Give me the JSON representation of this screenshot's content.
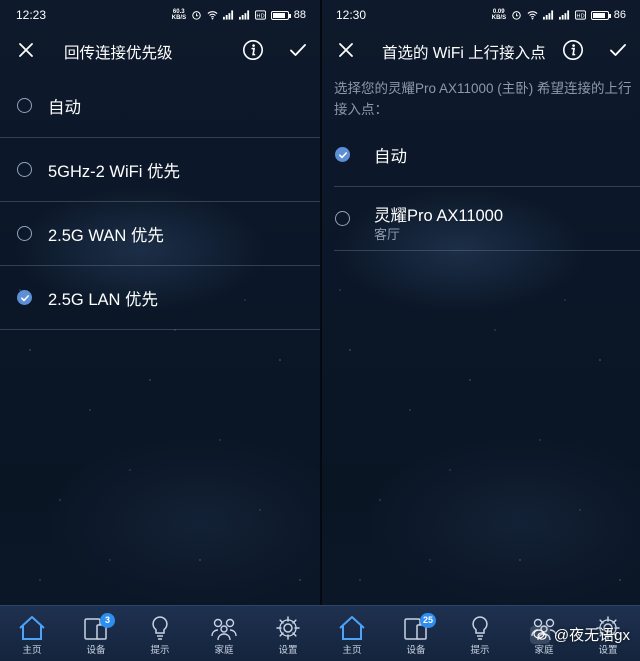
{
  "left": {
    "status": {
      "time": "12:23",
      "speed_top": "60.3",
      "speed_unit": "KB/S",
      "battery": "88",
      "battery_fill": 0.88
    },
    "header": {
      "title": "回传连接优先级"
    },
    "options": [
      {
        "label": "自动",
        "selected": false
      },
      {
        "label": "5GHz-2 WiFi 优先",
        "selected": false
      },
      {
        "label": "2.5G WAN 优先",
        "selected": false
      },
      {
        "label": "2.5G LAN 优先",
        "selected": true
      }
    ]
  },
  "right": {
    "status": {
      "time": "12:30",
      "speed_top": "0.09",
      "speed_unit": "KB/S",
      "battery": "86",
      "battery_fill": 0.86
    },
    "header": {
      "title": "首选的 WiFi 上行接入点"
    },
    "description": "选择您的灵耀Pro AX11000 (主卧) 希望连接的上行接入点：",
    "options": [
      {
        "label": "自动",
        "sub": "",
        "selected": true
      },
      {
        "label": "灵耀Pro AX11000",
        "sub": "客厅",
        "selected": false
      }
    ]
  },
  "tabbar": {
    "tabs": [
      {
        "label": "主页",
        "icon": "home-icon"
      },
      {
        "label": "设备",
        "icon": "devices-icon"
      },
      {
        "label": "提示",
        "icon": "bulb-icon"
      },
      {
        "label": "家庭",
        "icon": "family-icon"
      },
      {
        "label": "设置",
        "icon": "gear-icon"
      }
    ],
    "left_device_badge": "3",
    "right_device_badge": "25"
  },
  "watermark": {
    "text": "@夜无语gx"
  },
  "colors": {
    "accent": "#5c8fd6",
    "badge": "#2e8ef0",
    "tabbar": "#1a2c48",
    "background": "#0b1728"
  }
}
